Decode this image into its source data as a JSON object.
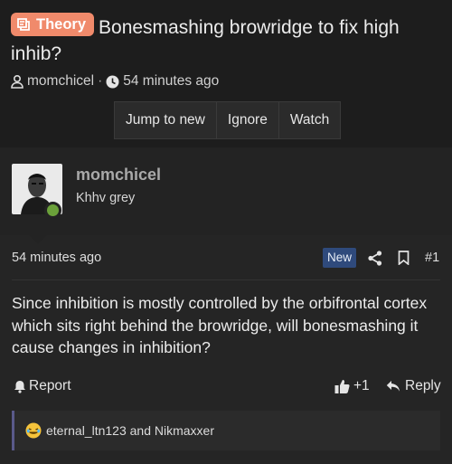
{
  "thread": {
    "prefix": "Theory",
    "title": "Bonesmashing browridge to fix high inhib?",
    "author": "momchicel",
    "separator": "·",
    "time": "54 minutes ago"
  },
  "thread_buttons": {
    "jump": "Jump to new",
    "ignore": "Ignore",
    "watch": "Watch"
  },
  "post": {
    "username": "momchicel",
    "user_title": "Khhv grey",
    "time": "54 minutes ago",
    "badge": "New",
    "number": "#1",
    "body": "Since inhibition is mostly controlled by the orbifrontal cortex which sits right behind the browridge, will bonesmashing it cause changes in inhibition?",
    "report": "Report",
    "likes": "+1",
    "reply": "Reply",
    "reactions": "eternal_ltn123 and Nikmaxxer"
  },
  "colors": {
    "prefix_bg": "#f08a6b",
    "new_badge": "#2f4a7c",
    "online": "#6ba13a",
    "reaction_border": "#5a5a8a"
  }
}
